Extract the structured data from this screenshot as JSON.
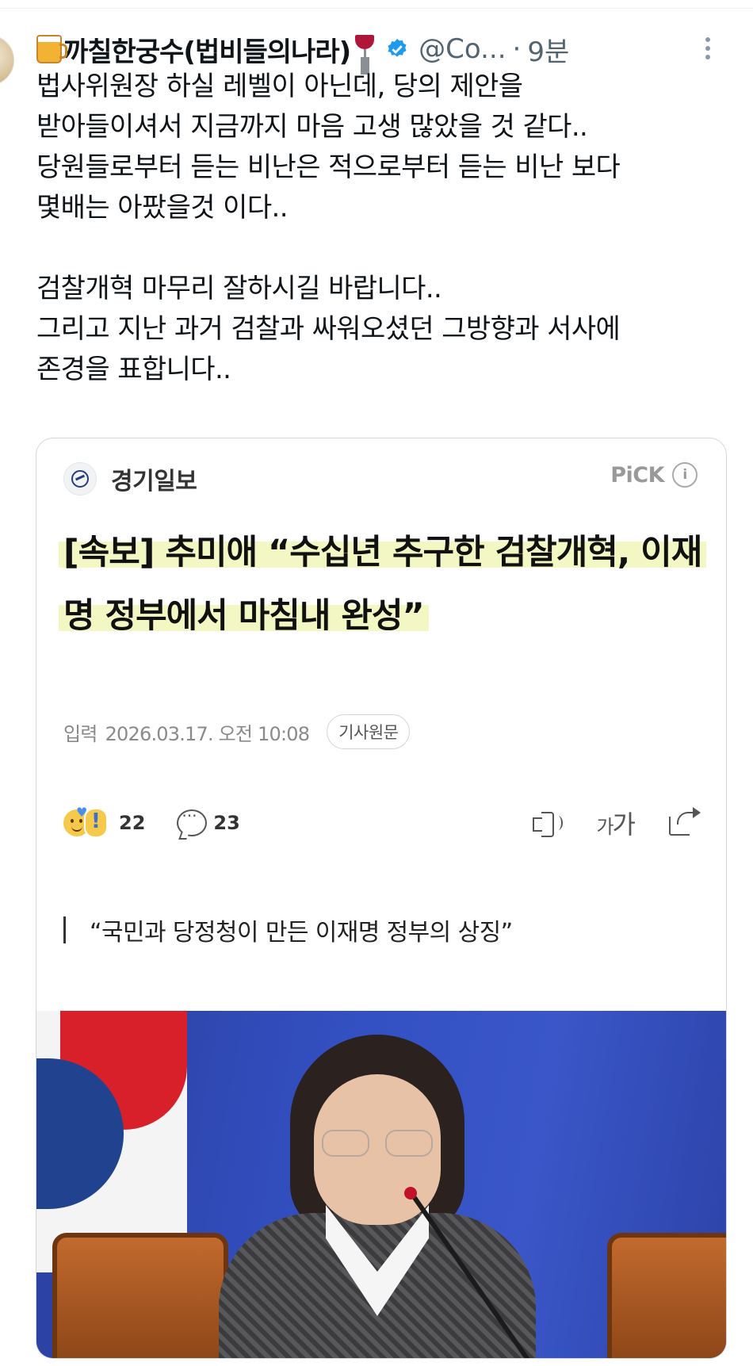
{
  "tweet": {
    "display_name": "까칠한궁수(법비들의나라)",
    "handle": "@Co...",
    "separator": "·",
    "time": "9분",
    "body": "법사위원장 하실 레벨이 아닌데, 당의 제안을\n받아들이셔서 지금까지 마음 고생 많았을 것 같다..\n당원들로부터 듣는 비난은 적으로부터 듣는 비난 보다\n몇배는 아팠을것 이다..\n\n검찰개혁 마무리 잘하시길 바랍니다..\n그리고 지난 과거 검찰과 싸워오셨던 그방향과 서사에\n존경을 표합니다.."
  },
  "card": {
    "publisher": "경기일보",
    "pick_label": "PiCK",
    "info_icon": "i",
    "headline": "[속보] 추미애 “수십년 추구한 검찰개혁, 이재명 정부에서 마침내 완성”",
    "meta_label": "입력",
    "meta_date": "2026.03.17. 오전 10:08",
    "original_button": "기사원문",
    "reaction_count": "22",
    "comment_count": "23",
    "font_size_small": "가",
    "font_size_large": "가",
    "quote": "“국민과 당정청이 만든 이재명 정부의 상징”"
  },
  "colors": {
    "verified": "#1d9bf0",
    "highlight": "#f3f7c4",
    "muted": "#536471"
  },
  "icons": [
    "beer-emoji",
    "wine-emoji",
    "verified-icon",
    "more-icon",
    "info-icon",
    "reaction-icon",
    "comment-icon",
    "speaker-icon",
    "share-icon"
  ]
}
